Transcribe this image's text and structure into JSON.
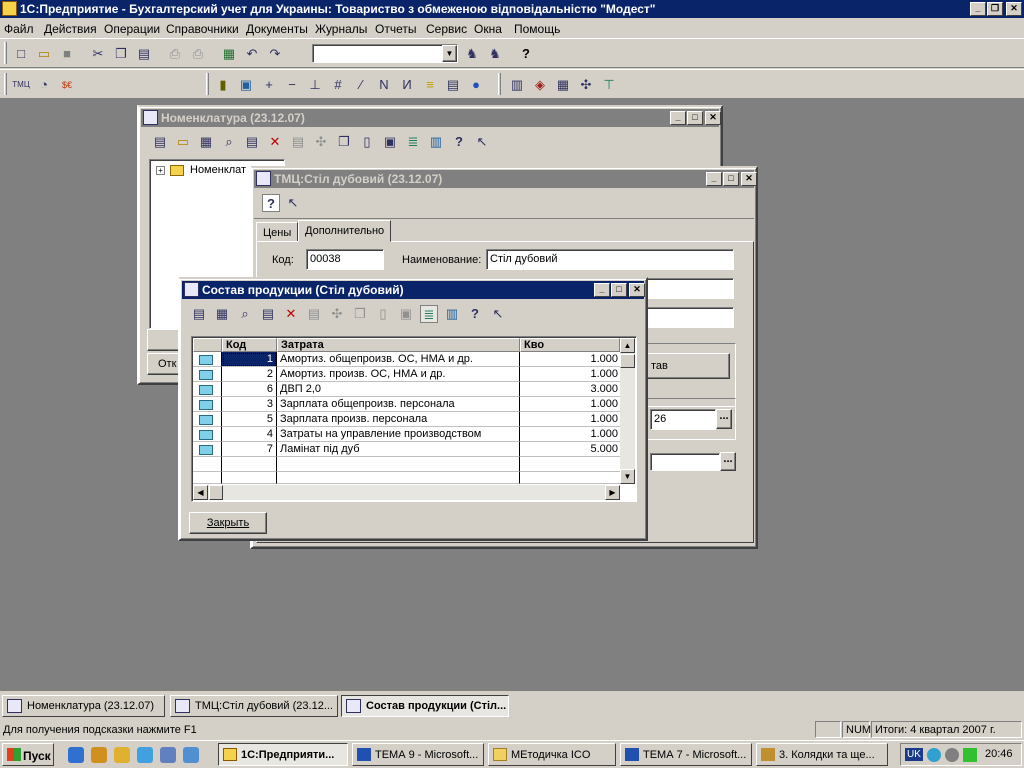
{
  "app": {
    "title": "1С:Предприятие - Бухгалтерский учет для Украины: Товариство  з  обмеженою  відповідальністю  \"Модест\"",
    "minimize": "_",
    "maximize": "❐",
    "close": "✕"
  },
  "menu": [
    "Файл",
    "Действия",
    "Операции",
    "Справочники",
    "Документы",
    "Журналы",
    "Отчеты",
    "Сервис",
    "Окна",
    "Помощь"
  ],
  "toolbar": {
    "combo_value": "",
    "icons1": [
      "new-icon",
      "open-icon",
      "save-icon",
      "cut-icon",
      "copy-icon",
      "paste-icon",
      "print-icon",
      "print-preview-icon",
      "calendar-icon",
      "undo-icon",
      "redo-icon",
      "find-icon",
      "find-next-icon",
      "help-icon"
    ],
    "icons2": [
      "tmc-icon",
      "calculator-icon",
      "currency-icon",
      "bars-icon",
      "add-doc-icon",
      "plus-icon",
      "minus-icon",
      "balance-icon",
      "ruler-icon",
      "link-icon",
      "arrow-n-icon",
      "arrow-reverse-icon",
      "coins-icon",
      "cash-register-icon",
      "globe-icon",
      "chart-icon",
      "journal-icon",
      "book-icon",
      "tools-icon",
      "filter-icon"
    ]
  },
  "nomenclature_window": {
    "title": "Номенклатура (23.12.07)",
    "tree_item": "Номенклат",
    "open_button": "Отк"
  },
  "tmc_window": {
    "title": "ТМЦ:Стіл дубовий (23.12.07)",
    "tabs": [
      "Цены",
      "Дополнительно"
    ],
    "code_label": "Код:",
    "code_value": "00038",
    "name_label": "Наименование:",
    "name_value": "Стіл дубовий",
    "button_fragment": "тав",
    "field_fragment": "26",
    "ellipsis": "..."
  },
  "composition_window": {
    "title": "Состав продукции (Стіл дубовий)",
    "columns": [
      "Код",
      "Затрата",
      "Кво"
    ],
    "rows": [
      {
        "code": "1",
        "cost": "Амортиз. общепроизв. ОС, НМА и др.",
        "qty": "1.000"
      },
      {
        "code": "2",
        "cost": "Амортиз. произв. ОС, НМА и др.",
        "qty": "1.000"
      },
      {
        "code": "6",
        "cost": "ДВП 2,0",
        "qty": "3.000"
      },
      {
        "code": "3",
        "cost": "Зарплата общепроизв. персонала",
        "qty": "1.000"
      },
      {
        "code": "5",
        "cost": "Зарплата произв. персонала",
        "qty": "1.000"
      },
      {
        "code": "4",
        "cost": "Затраты на управление производством",
        "qty": "1.000"
      },
      {
        "code": "7",
        "cost": "Ламінат  під дуб",
        "qty": "5.000"
      }
    ],
    "close_button": "Закрыть"
  },
  "window_tabs": [
    "Номенклатура (23.12.07)",
    "ТМЦ:Стіл дубовий (23.12...",
    "Состав продукции (Стіл..."
  ],
  "status": {
    "hint": "Для получения подсказки нажмите F1",
    "num": "NUM",
    "totals": "Итоги: 4 квартал 2007 г."
  },
  "taskbar": {
    "start": "Пуск",
    "buttons": [
      "1С:Предприяти...",
      "ТЕМА 9 - Microsoft...",
      "МЕтодичка ICO",
      "ТЕМА 7 - Microsoft...",
      "3. Колядки та ще..."
    ],
    "lang": "UK",
    "clock": "20:46"
  },
  "colors": {
    "active_title": "#0a246a",
    "inactive_title": "#808080",
    "desktop_mdi": "#808080",
    "face": "#d4d0c8"
  }
}
